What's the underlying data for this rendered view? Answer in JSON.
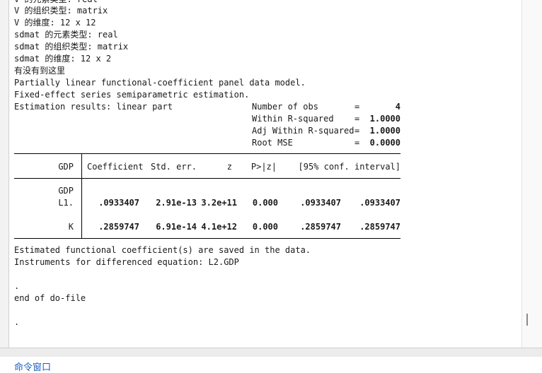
{
  "output": {
    "lines": [
      "V 的元素类型: real",
      "V 的组织类型: matrix",
      "V 的维度: 12 x 12",
      "sdmat 的元素类型: real",
      "sdmat 的组织类型: matrix",
      "sdmat 的维度: 12 x 2",
      "有没有到这里",
      "Partially linear functional-coefficient panel data model.",
      "Fixed-effect series semiparametric estimation.",
      "Estimation results: linear part"
    ],
    "stats": [
      {
        "label": "Number of obs",
        "eq": "=",
        "value": "4"
      },
      {
        "label": "Within R-squared",
        "eq": "=",
        "value": "1.0000"
      },
      {
        "label": "Adj Within R-squared",
        "eq": "=",
        "value": "1.0000"
      },
      {
        "label": "Root MSE",
        "eq": "=",
        "value": "0.0000"
      }
    ],
    "table": {
      "depvar": "GDP",
      "headers": [
        "Coefficient",
        "Std. err.",
        "z",
        "P>|z|",
        "[95% conf. interval]"
      ],
      "group_label": "GDP",
      "rows": [
        {
          "name": "L1.",
          "coef": ".0933407",
          "se": "2.91e-13",
          "z": "3.2e+11",
          "p": "0.000",
          "lo": ".0933407",
          "hi": ".0933407"
        },
        {
          "name": "K",
          "coef": ".2859747",
          "se": "6.91e-14",
          "z": "4.1e+12",
          "p": "0.000",
          "lo": ".2859747",
          "hi": ".2859747"
        }
      ]
    },
    "footer_lines": [
      "Estimated functional coefficient(s) are saved in the data.",
      "Instruments for differenced equation: L2.GDP"
    ],
    "dot1": ".",
    "end": "end of do-file",
    "dot2": "."
  },
  "tabs": {
    "command_window": "命令窗口"
  }
}
